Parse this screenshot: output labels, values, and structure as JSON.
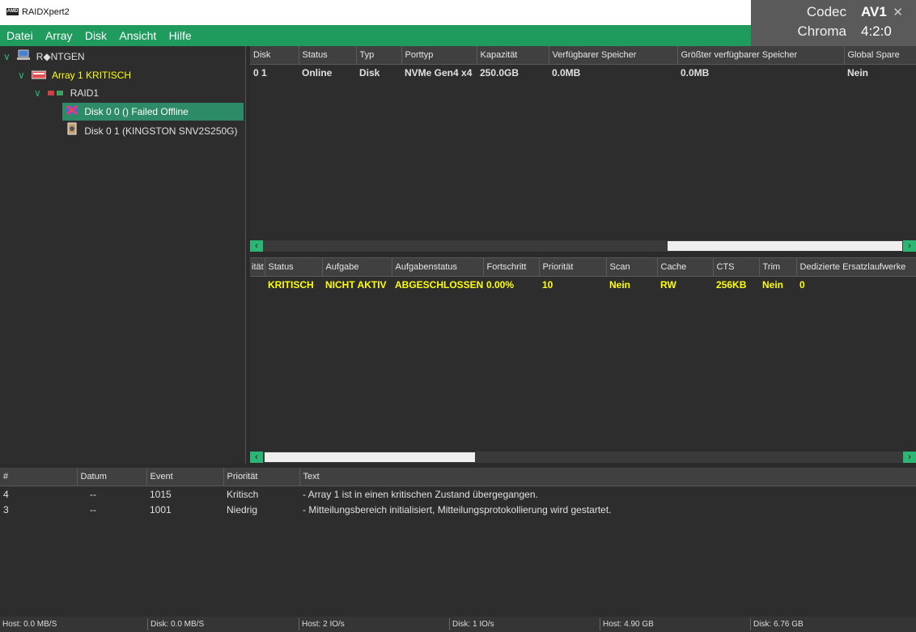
{
  "window": {
    "title": "RAIDXpert2",
    "logo_text": "AMD"
  },
  "overlay": {
    "codec_label": "Codec",
    "codec_value": "AV1",
    "chroma_label": "Chroma",
    "chroma_value": "4:2:0",
    "close": "✕"
  },
  "menu": [
    "Datei",
    "Array",
    "Disk",
    "Ansicht",
    "Hilfe"
  ],
  "tree": {
    "host": "R◆NTGEN",
    "array": "Array 1  KRITISCH",
    "raid": "RAID1",
    "disk_failed": "Disk 0 0 ()  Failed Offline",
    "disk_ok": "Disk 0 1 (KINGSTON SNV2S250G)"
  },
  "disk_table": {
    "headers": [
      "Disk",
      "Status",
      "Typ",
      "Porttyp",
      "Kapazität",
      "Verfügbarer Speicher",
      "Größter verfügbarer Speicher",
      "Global Spare"
    ],
    "rows": [
      [
        "0 1",
        "Online",
        "Disk",
        "NVMe Gen4 x4",
        "250.0GB",
        "0.0MB",
        "0.0MB",
        "Nein"
      ]
    ]
  },
  "array_table": {
    "headers": [
      "ität",
      "Status",
      "Aufgabe",
      "Aufgabenstatus",
      "Fortschritt",
      "Priorität",
      "Scan",
      "Cache",
      "CTS",
      "Trim",
      "Dedizierte Ersatzlaufwerke"
    ],
    "rows": [
      [
        "",
        "KRITISCH",
        "NICHT AKTIV",
        "ABGESCHLOSSEN",
        "0.00%",
        "10",
        "Nein",
        "RW",
        "256KB",
        "Nein",
        "0"
      ]
    ]
  },
  "event_table": {
    "headers": [
      "#",
      "Datum",
      "Event",
      "Priorität",
      "Text"
    ],
    "rows": [
      [
        "4",
        "--",
        "1015",
        "Kritisch",
        "- Array 1 ist in einen kritischen Zustand übergegangen."
      ],
      [
        "3",
        "--",
        "1001",
        "Niedrig",
        "- Mitteilungsbereich initialisiert, Mitteilungsprotokollierung wird gestartet."
      ]
    ]
  },
  "statusbar": {
    "host_rate": "Host: 0.0 MB/S",
    "disk_rate": "Disk: 0.0 MB/S",
    "host_io": "Host: 2 IO/s",
    "disk_io": "Disk: 1 IO/s",
    "host_size": "Host: 4.90 GB",
    "disk_size": "Disk: 6.76 GB"
  },
  "colors": {
    "accent": "#1f9b5d",
    "highlight": "#ffff00",
    "selected": "#2e8b67"
  }
}
